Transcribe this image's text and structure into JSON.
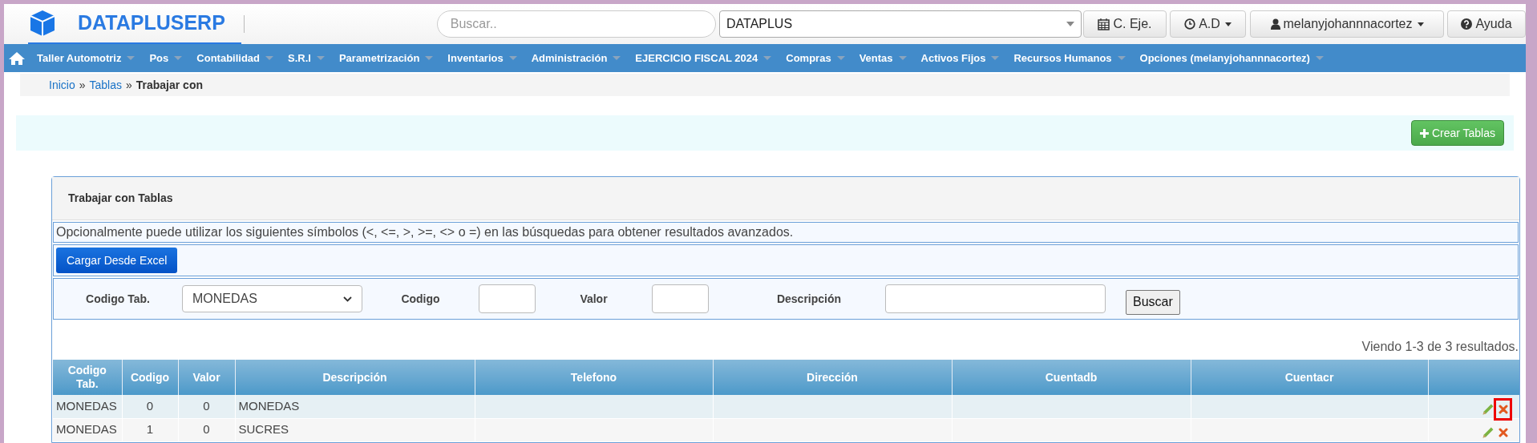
{
  "header": {
    "brand": "DATAPLUSERP",
    "search": {
      "placeholder": "Buscar.."
    },
    "company_select": "DATAPLUS",
    "buttons": [
      {
        "kind": "calendar",
        "label": "C. Eje.",
        "dropdown": false
      },
      {
        "kind": "clock",
        "label": "A.D",
        "dropdown": true
      },
      {
        "kind": "user",
        "label": "melanyjohannnacortez",
        "dropdown": true
      },
      {
        "kind": "help",
        "label": "Ayuda",
        "dropdown": false
      }
    ]
  },
  "nav": {
    "items": [
      {
        "label": "Taller Automotriz"
      },
      {
        "label": "Pos"
      },
      {
        "label": "Contabilidad"
      },
      {
        "label": "S.R.I"
      },
      {
        "label": "Parametrización"
      },
      {
        "label": "Inventarios"
      },
      {
        "label": "Administración"
      },
      {
        "label": "EJERCICIO FISCAL 2024"
      },
      {
        "label": "Compras"
      },
      {
        "label": "Ventas"
      },
      {
        "label": "Activos Fijos"
      },
      {
        "label": "Recursos Humanos"
      },
      {
        "label": "Opciones (melanyjohannnacortez)"
      }
    ]
  },
  "breadcrumb_separator": "»",
  "breadcrumb": [
    {
      "label": "Inicio",
      "link": true
    },
    {
      "label": "Tablas",
      "link": true
    },
    {
      "label": "Trabajar con",
      "link": false
    }
  ],
  "create_button": "Crear Tablas",
  "panel": {
    "title": "Trabajar con Tablas",
    "hint": "Opcionalmente puede utilizar los siguientes símbolos (<, <=, >, >=, <> o =) en las búsquedas para obtener resultados avanzados.",
    "excel_button": "Cargar Desde Excel",
    "filters": [
      {
        "kind": "select",
        "label": "Codigo Tab.",
        "value": "MONEDAS"
      },
      {
        "kind": "input",
        "label": "Codigo"
      },
      {
        "kind": "input",
        "label": "Valor"
      },
      {
        "kind": "wide_input",
        "label": "Descripción"
      }
    ],
    "search_button": "Buscar",
    "summary": "Viendo 1-3 de 3 resultados.",
    "table": {
      "columns": [
        "Codigo Tab.",
        "Codigo",
        "Valor",
        "Descripción",
        "Telefono",
        "Dirección",
        "Cuentadb",
        "Cuentacr"
      ],
      "rows": [
        {
          "cells": [
            "MONEDAS",
            "0",
            "0",
            "MONEDAS",
            "",
            "",
            "",
            ""
          ],
          "delete_highlighted": true
        },
        {
          "cells": [
            "MONEDAS",
            "1",
            "0",
            "SUCRES",
            "",
            "",
            "",
            ""
          ],
          "delete_highlighted": false
        }
      ]
    }
  }
}
